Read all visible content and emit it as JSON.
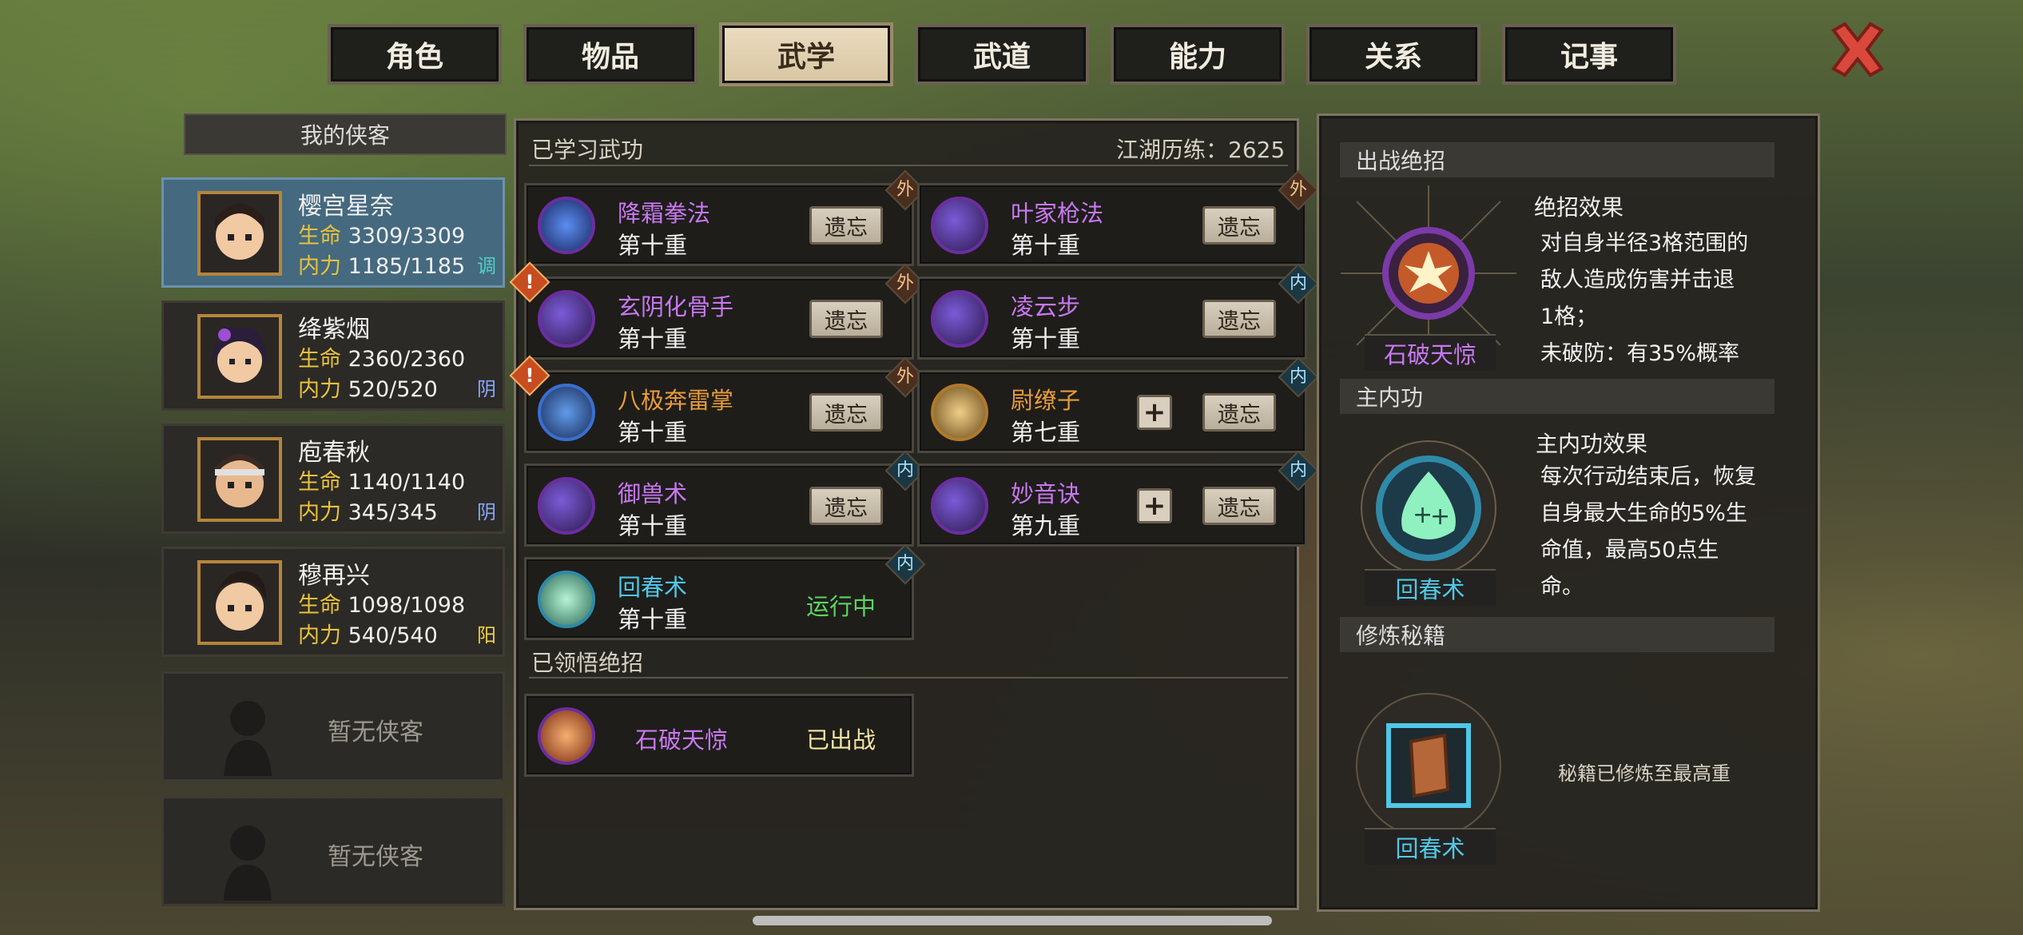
{
  "tabs": [
    "角色",
    "物品",
    "武学",
    "武道",
    "能力",
    "关系",
    "记事"
  ],
  "active_tab": "武学",
  "left": {
    "header": "我的侠客",
    "characters": [
      {
        "name": "樱宫星奈",
        "hp_label": "生命",
        "hp": "3309/3309",
        "mp_label": "内力",
        "mp": "1185/1185",
        "tag": "调",
        "tag_color": "#4fd1c5"
      },
      {
        "name": "绛紫烟",
        "hp_label": "生命",
        "hp": "2360/2360",
        "mp_label": "内力",
        "mp": "520/520",
        "tag": "阴",
        "tag_color": "#8aa8ff"
      },
      {
        "name": "庖春秋",
        "hp_label": "生命",
        "hp": "1140/1140",
        "mp_label": "内力",
        "mp": "345/345",
        "tag": "阴",
        "tag_color": "#8aa8ff"
      },
      {
        "name": "穆再兴",
        "hp_label": "生命",
        "hp": "1098/1098",
        "mp_label": "内力",
        "mp": "540/540",
        "tag": "阳",
        "tag_color": "#f2d24a"
      }
    ],
    "empty_slots": [
      "暂无侠客",
      "暂无侠客"
    ]
  },
  "middle": {
    "learned_title": "已学习武功",
    "experience": "江湖历练：2625",
    "forget_label": "遗忘",
    "skills": [
      {
        "name": "降霜拳法",
        "level": "第十重",
        "type": "外",
        "name_color": "#c878f0",
        "icon": "frost-fist-icon"
      },
      {
        "name": "叶家枪法",
        "level": "第十重",
        "type": "外",
        "name_color": "#c878f0",
        "icon": "spear-icon"
      },
      {
        "name": "玄阴化骨手",
        "level": "第十重",
        "type": "外",
        "name_color": "#c878f0",
        "icon": "yin-hand-icon",
        "warning": "!"
      },
      {
        "name": "凌云步",
        "level": "第十重",
        "type": "内",
        "name_color": "#c878f0",
        "icon": "step-icon"
      },
      {
        "name": "八极奔雷掌",
        "level": "第十重",
        "type": "外",
        "name_color": "#e89b3a",
        "icon": "thunder-palm-icon",
        "warning": "!"
      },
      {
        "name": "尉缭子",
        "level": "第七重",
        "type": "内",
        "name_color": "#e89b3a",
        "icon": "arm-icon",
        "plus": "+"
      },
      {
        "name": "御兽术",
        "level": "第十重",
        "type": "内",
        "name_color": "#c878f0",
        "icon": "claw-icon"
      },
      {
        "name": "妙音诀",
        "level": "第九重",
        "type": "内",
        "name_color": "#c878f0",
        "icon": "sound-icon",
        "plus": "+"
      },
      {
        "name": "回春术",
        "level": "第十重",
        "type": "内",
        "name_color": "#4fc8e8",
        "icon": "heal-icon",
        "status": "运行中"
      }
    ],
    "ultimate_title": "已领悟绝招",
    "ultimate": {
      "name": "石破天惊",
      "status": "已出战"
    }
  },
  "right": {
    "battle_header": "出战绝招",
    "ult_name": "石破天惊",
    "ult_effect_title": "绝招效果",
    "ult_effect_lines": [
      "对自身半径3格范围的",
      "敌人造成伤害并击退",
      "1格；",
      "未破防：有35%概率"
    ],
    "main_header": "主内功",
    "main_name": "回春术",
    "main_effect_title": "主内功效果",
    "main_effect_lines": [
      "每次行动结束后，恢复",
      "自身最大生命的5%生",
      "命值，最高50点生",
      "命。"
    ],
    "manual_header": "修炼秘籍",
    "manual_name": "回春术",
    "manual_status": "秘籍已修炼至最高重"
  }
}
